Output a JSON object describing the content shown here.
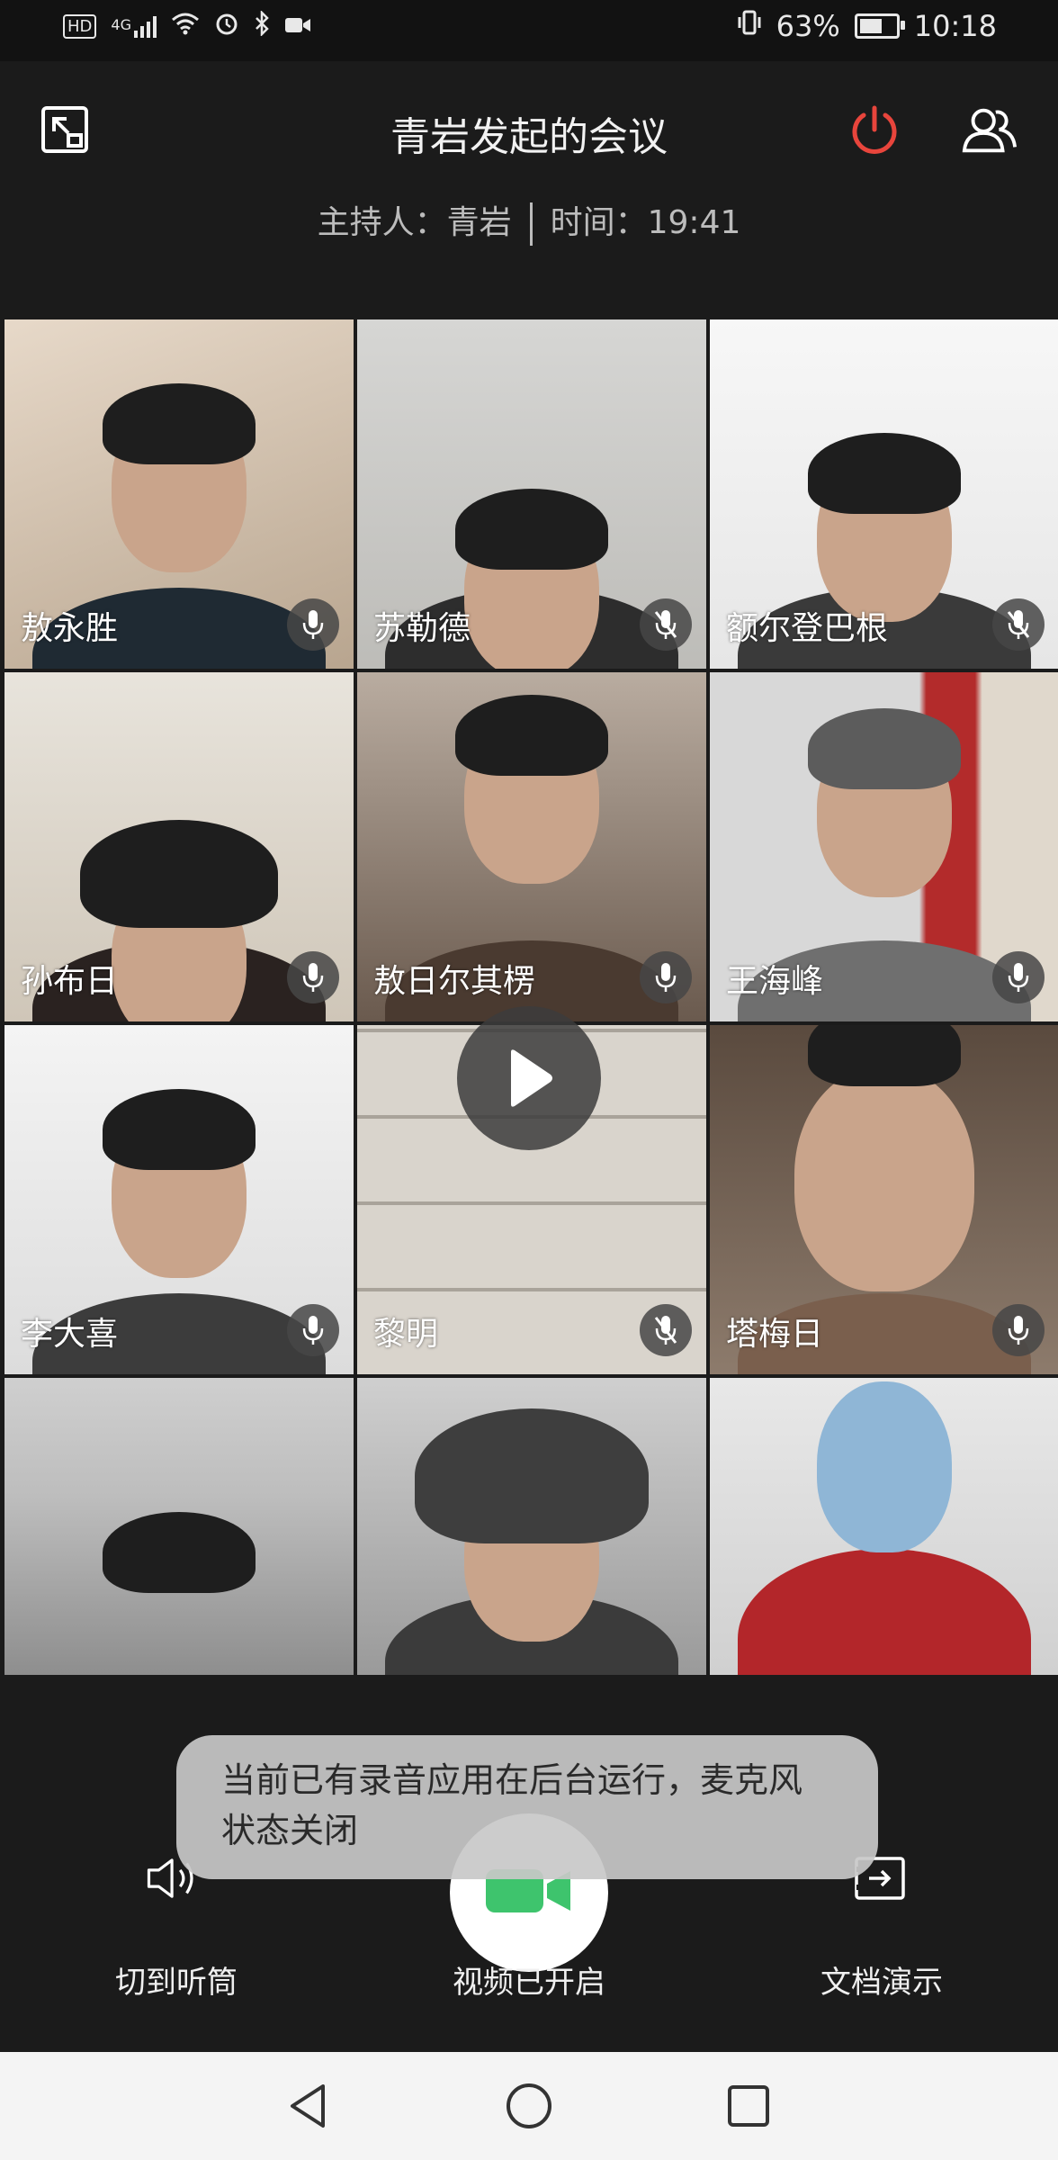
{
  "status_bar": {
    "left_icons": [
      "hd-icon",
      "signal-4g-icon",
      "wifi-icon",
      "alarm-icon",
      "bluetooth-icon",
      "video-record-icon"
    ],
    "hd_text": "HD",
    "network_text": "4G",
    "battery_percent": "63%",
    "battery_level": 0.63,
    "time": "10:18"
  },
  "header": {
    "title": "青岩发起的会议",
    "host": "主持人：青岩",
    "time": "时间：19:41",
    "end_color": "#e8453c"
  },
  "participants": [
    {
      "name": "敖永胜",
      "mic": "on"
    },
    {
      "name": "苏勒德",
      "mic": "off"
    },
    {
      "name": "额尔登巴根",
      "mic": "off"
    },
    {
      "name": "孙布日",
      "mic": "on"
    },
    {
      "name": "敖日尔其楞",
      "mic": "on"
    },
    {
      "name": "王海峰",
      "mic": "on"
    },
    {
      "name": "李大喜",
      "mic": "on"
    },
    {
      "name": "黎明",
      "mic": "off"
    },
    {
      "name": "塔梅日",
      "mic": "on"
    },
    {
      "name": "",
      "mic": ""
    },
    {
      "name": "",
      "mic": ""
    },
    {
      "name": "",
      "mic": ""
    }
  ],
  "controls": {
    "speaker_label": "切到听筒",
    "video_label": "视频已开启",
    "doc_label": "文档演示",
    "video_color": "#3ec46d"
  },
  "toast": {
    "text": "当前已有录音应用在后台运行，麦克风状态关闭"
  }
}
